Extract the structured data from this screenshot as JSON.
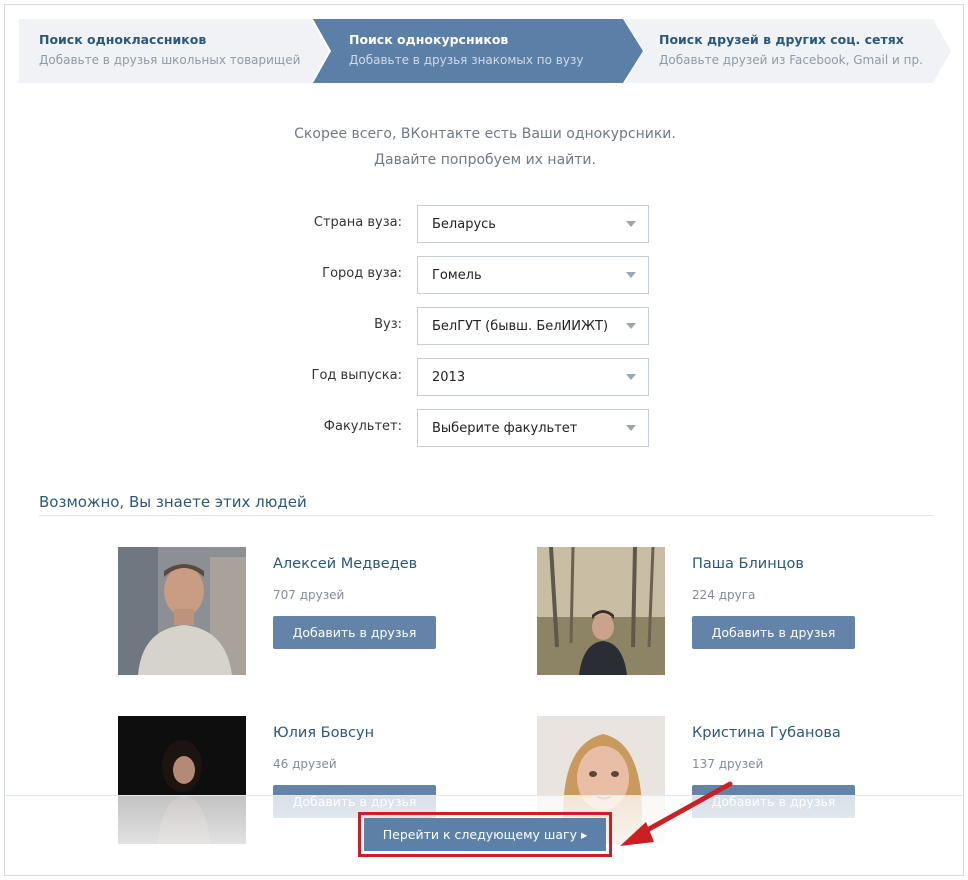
{
  "steps": [
    {
      "title": "Поиск одноклассников",
      "subtitle": "Добавьте в друзья школьных товарищей"
    },
    {
      "title": "Поиск однокурсников",
      "subtitle": "Добавьте в друзья знакомых по вузу"
    },
    {
      "title": "Поиск друзей в других соц. сетях",
      "subtitle": "Добавьте друзей из Facebook, Gmail и пр."
    }
  ],
  "intro": {
    "line1": "Скорее всего, ВКонтакте есть Ваши однокурсники.",
    "line2": "Давайте попробуем их найти."
  },
  "form": {
    "country_label": "Страна вуза:",
    "country_value": "Беларусь",
    "city_label": "Город вуза:",
    "city_value": "Гомель",
    "university_label": "Вуз:",
    "university_value": "БелГУТ (бывш. БелИИЖТ)",
    "year_label": "Год выпуска:",
    "year_value": "2013",
    "faculty_label": "Факультет:",
    "faculty_value": "Выберите факультет"
  },
  "suggestions": {
    "title": "Возможно, Вы знаете этих людей",
    "people": [
      {
        "name": "Алексей Медведев",
        "friends": "707 друзей",
        "add_label": "Добавить в друзья"
      },
      {
        "name": "Паша Блинцов",
        "friends": "224 друга",
        "add_label": "Добавить в друзья"
      },
      {
        "name": "Юлия Бовсун",
        "friends": "46 друзей",
        "add_label": "Добавить в друзья"
      },
      {
        "name": "Кристина Губанова",
        "friends": "137 друзей",
        "add_label": "Добавить в друзья"
      }
    ]
  },
  "next_button": {
    "label": "Перейти к следующему шагу ▸"
  },
  "colors": {
    "accent": "#5d80a8",
    "link": "#2b587a",
    "highlight": "#cc1f24",
    "active_step": "#5b7fa6"
  }
}
